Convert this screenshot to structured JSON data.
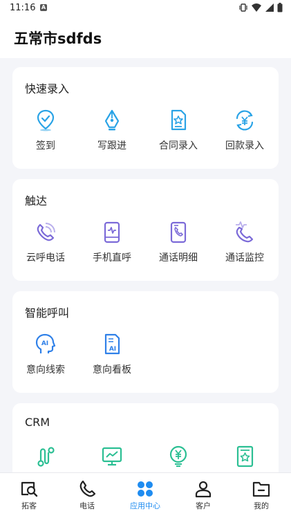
{
  "status_bar": {
    "time": "11:16",
    "notification_letter": "A"
  },
  "header": {
    "title": "五常市sdfds"
  },
  "sections": [
    {
      "title": "快速录入",
      "items": [
        {
          "label": "签到",
          "icon": "location-check-icon",
          "color": "#29a3e6"
        },
        {
          "label": "写跟进",
          "icon": "pen-nib-icon",
          "color": "#29a3e6"
        },
        {
          "label": "合同录入",
          "icon": "contract-icon",
          "color": "#29a3e6"
        },
        {
          "label": "回款录入",
          "icon": "payment-return-icon",
          "color": "#29a3e6"
        }
      ]
    },
    {
      "title": "触达",
      "items": [
        {
          "label": "云呼电话",
          "icon": "cloud-call-icon",
          "color": "#7b6ad8"
        },
        {
          "label": "手机直呼",
          "icon": "mobile-call-icon",
          "color": "#7b6ad8"
        },
        {
          "label": "通话明细",
          "icon": "call-detail-icon",
          "color": "#7b6ad8"
        },
        {
          "label": "通话监控",
          "icon": "call-monitor-icon",
          "color": "#7b6ad8"
        }
      ]
    },
    {
      "title": "智能呼叫",
      "items": [
        {
          "label": "意向线索",
          "icon": "ai-head-icon",
          "color": "#2f80e8"
        },
        {
          "label": "意向看板",
          "icon": "ai-board-icon",
          "color": "#2f80e8"
        }
      ]
    },
    {
      "title": "CRM",
      "items": [
        {
          "label": "",
          "icon": "flow-icon",
          "color": "#2bbf93"
        },
        {
          "label": "",
          "icon": "monitor-chart-icon",
          "color": "#2bbf93"
        },
        {
          "label": "",
          "icon": "yuan-bulb-icon",
          "color": "#2bbf93"
        },
        {
          "label": "",
          "icon": "star-doc-icon",
          "color": "#2bbf93"
        }
      ]
    }
  ],
  "bottom_nav": [
    {
      "label": "拓客",
      "icon": "search-box-icon"
    },
    {
      "label": "电话",
      "icon": "phone-icon"
    },
    {
      "label": "应用中心",
      "icon": "apps-icon",
      "active": true
    },
    {
      "label": "客户",
      "icon": "user-icon"
    },
    {
      "label": "我的",
      "icon": "folder-icon"
    }
  ],
  "colors": {
    "active_nav": "#1f8cf0",
    "background": "#f4f5f9"
  }
}
